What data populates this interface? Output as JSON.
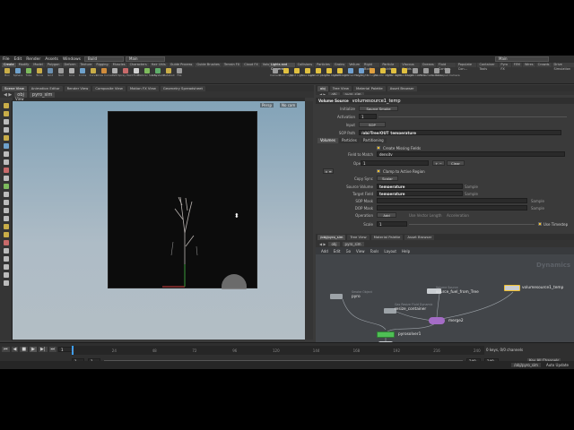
{
  "menubar": {
    "items": [
      "File",
      "Edit",
      "Render",
      "Assets",
      "Windows",
      "Help"
    ],
    "build_desktop": "Build",
    "main_desktop": "Main",
    "right_desktop": "Main"
  },
  "shelf": {
    "left_tabs": [
      "Create",
      "Modify",
      "Model",
      "Polygon",
      "Deform",
      "Texture",
      "Rigging",
      "Muscles",
      "Characters",
      "Hair Utils",
      "Guide Process",
      "Guide Brushes",
      "Terrain FX",
      "Cloud FX",
      "Volume"
    ],
    "right_tabs": [
      "Lights and Cameras",
      "Collisions",
      "Particles",
      "Grains",
      "Vellum",
      "Rigid Bodies",
      "Particle Fluids",
      "Viscous Fluids",
      "Oceans",
      "Fluid Contai...",
      "Populate Con...",
      "Container Tools",
      "Pyro FX",
      "FEM",
      "Wires",
      "Crowds",
      "Drive Simulation"
    ],
    "left_tools": [
      {
        "label": "Box",
        "color": "#c9ad48"
      },
      {
        "label": "Sphere",
        "color": "#6fa2cc"
      },
      {
        "label": "Tube",
        "color": "#7dbb5d"
      },
      {
        "label": "Torus",
        "color": "#c9ad48"
      },
      {
        "label": "Grid",
        "color": "#6a8fb0"
      },
      {
        "label": "Null",
        "color": "#9b9b9b"
      },
      {
        "label": "Line",
        "color": "#b0b0b0"
      },
      {
        "label": "Circle",
        "color": "#6fa2cc"
      },
      {
        "label": "Curve",
        "color": "#c9ad48"
      },
      {
        "label": "Draw Curve",
        "color": "#d08c3c"
      },
      {
        "label": "Path",
        "color": "#b0b0b0"
      },
      {
        "label": "Spray Paint",
        "color": "#c86a6a"
      },
      {
        "label": "Font",
        "color": "#d0d0d0"
      },
      {
        "label": "Platonic Solids",
        "color": "#7dbb5d"
      },
      {
        "label": "L-System",
        "color": "#5fae6a"
      },
      {
        "label": "Metaball",
        "color": "#c9ad48"
      },
      {
        "label": "File",
        "color": "#9b9b9b"
      }
    ],
    "right_tools": [
      {
        "label": "Camera",
        "color": "#9b9b9b"
      },
      {
        "label": "Point Light",
        "color": "#e0c040"
      },
      {
        "label": "Spot Light",
        "color": "#e0c040"
      },
      {
        "label": "Area Light",
        "color": "#e0c040"
      },
      {
        "label": "Geometry Light",
        "color": "#e0c040"
      },
      {
        "label": "Volume Light",
        "color": "#e0c040"
      },
      {
        "label": "Distant Light",
        "color": "#e0c040"
      },
      {
        "label": "Environment Light",
        "color": "#70a0d0"
      },
      {
        "label": "Sky Light",
        "color": "#70a0d0"
      },
      {
        "label": "GI Light",
        "color": "#e0a040"
      },
      {
        "label": "Caustic Light",
        "color": "#e0c040"
      },
      {
        "label": "Portal Light",
        "color": "#e0c040"
      },
      {
        "label": "Ambient Light",
        "color": "#e0c040"
      },
      {
        "label": "Stereo Camera",
        "color": "#9b9b9b"
      },
      {
        "label": "VR Camera",
        "color": "#9b9b9b"
      },
      {
        "label": "Switcher",
        "color": "#9b9b9b"
      },
      {
        "label": "Gamepad Camera",
        "color": "#9b9b9b"
      }
    ]
  },
  "viewer": {
    "tabs": [
      "Scene View",
      "Animation Editor",
      "Render View",
      "Composite View",
      "Motion FX View",
      "Geometry Spreadsheet"
    ],
    "path": [
      "obj",
      "pyro_sim"
    ],
    "title": "View",
    "cam_menu": "Persp",
    "cam2_menu": "No cam"
  },
  "params": {
    "tabs": [
      "obj",
      "Tree View",
      "Material Palette",
      "Asset Browser"
    ],
    "path": [
      "obj",
      "pyro_sim"
    ],
    "node_type": "Volume Source",
    "node_name": "volumesource1_temp",
    "initialize_label": "Initialize",
    "initialize_value": "Source Smoke",
    "activation_label": "Activation",
    "activation_value": "1",
    "input_label": "Input",
    "input_value": "SOP",
    "sop_path_label": "SOP Path",
    "sop_path_value": "/obj/Tree/OUT_temperature",
    "sub_tabs": [
      "Volumes",
      "Particles",
      "Partitioning"
    ],
    "create_missing": "Create Missing Fields",
    "field_match_label": "Field to Match",
    "field_match_value": "density",
    "operations_label": "Operations",
    "operations_value": "1",
    "clear_button": "Clear",
    "clamp_label": "Clamp to Active Region",
    "copy_sync_label": "Copy Sync",
    "copy_sync_value": "Scalar",
    "source_volume_label": "Source Volume",
    "source_volume_value": "temperature",
    "source_volume_suffix": "Sample",
    "target_field_label": "Target Field",
    "target_field_value": "temperature",
    "target_field_suffix": "Sample",
    "sop_mask_label": "SOP Mask",
    "sop_mask_suffix": "Sample",
    "dop_mask_label": "DOP Mask",
    "dop_mask_suffix": "Sample",
    "operation_label": "Operation",
    "operation_value": "Add",
    "use_vector_length": "Use Vector Length",
    "acceleration": "Acceleration",
    "scale_label": "Scale",
    "scale_value": "1",
    "use_timestep": "Use Timestep"
  },
  "network": {
    "tabs": [
      "/obj/pyro_sim",
      "Tree View",
      "Material Palette",
      "Asset Browser"
    ],
    "path": [
      "obj",
      "pyro_sim"
    ],
    "menu": [
      "Add",
      "Edit",
      "Go",
      "View",
      "Tools",
      "Layout",
      "Help"
    ],
    "context_label": "Dynamics",
    "nodes": {
      "pyro": {
        "label": "pyro",
        "sub": "Smoke Object"
      },
      "source_fuel": {
        "label": "source_fuel_from_Tree",
        "sub": "Volume Source"
      },
      "volumesource": {
        "label": "volumesource1_temp"
      },
      "resize": {
        "label": "resize_container",
        "sub": "Gas Resize Fluid Dynamic"
      },
      "merge": {
        "label": "merge2"
      },
      "solver": {
        "label": "pyrosolver1"
      }
    }
  },
  "timeline": {
    "frame": "1",
    "start": "1",
    "start2": "1",
    "end": "240",
    "end2": "240",
    "ticks": [
      "1",
      "24",
      "48",
      "72",
      "96",
      "120",
      "144",
      "168",
      "192",
      "216",
      "240"
    ],
    "keys_info": "0 keys, 0/0 channels",
    "key_all": "Key All Channels",
    "auto_update": "Auto Update",
    "path_button": "/obj/pyro_sim"
  },
  "colors": {
    "accent": "#f0c030",
    "viewport_top": "#83a3b8",
    "node_bg": "#424549",
    "solver_green": "#4fbf55",
    "merge_purple": "#a46cc6"
  }
}
